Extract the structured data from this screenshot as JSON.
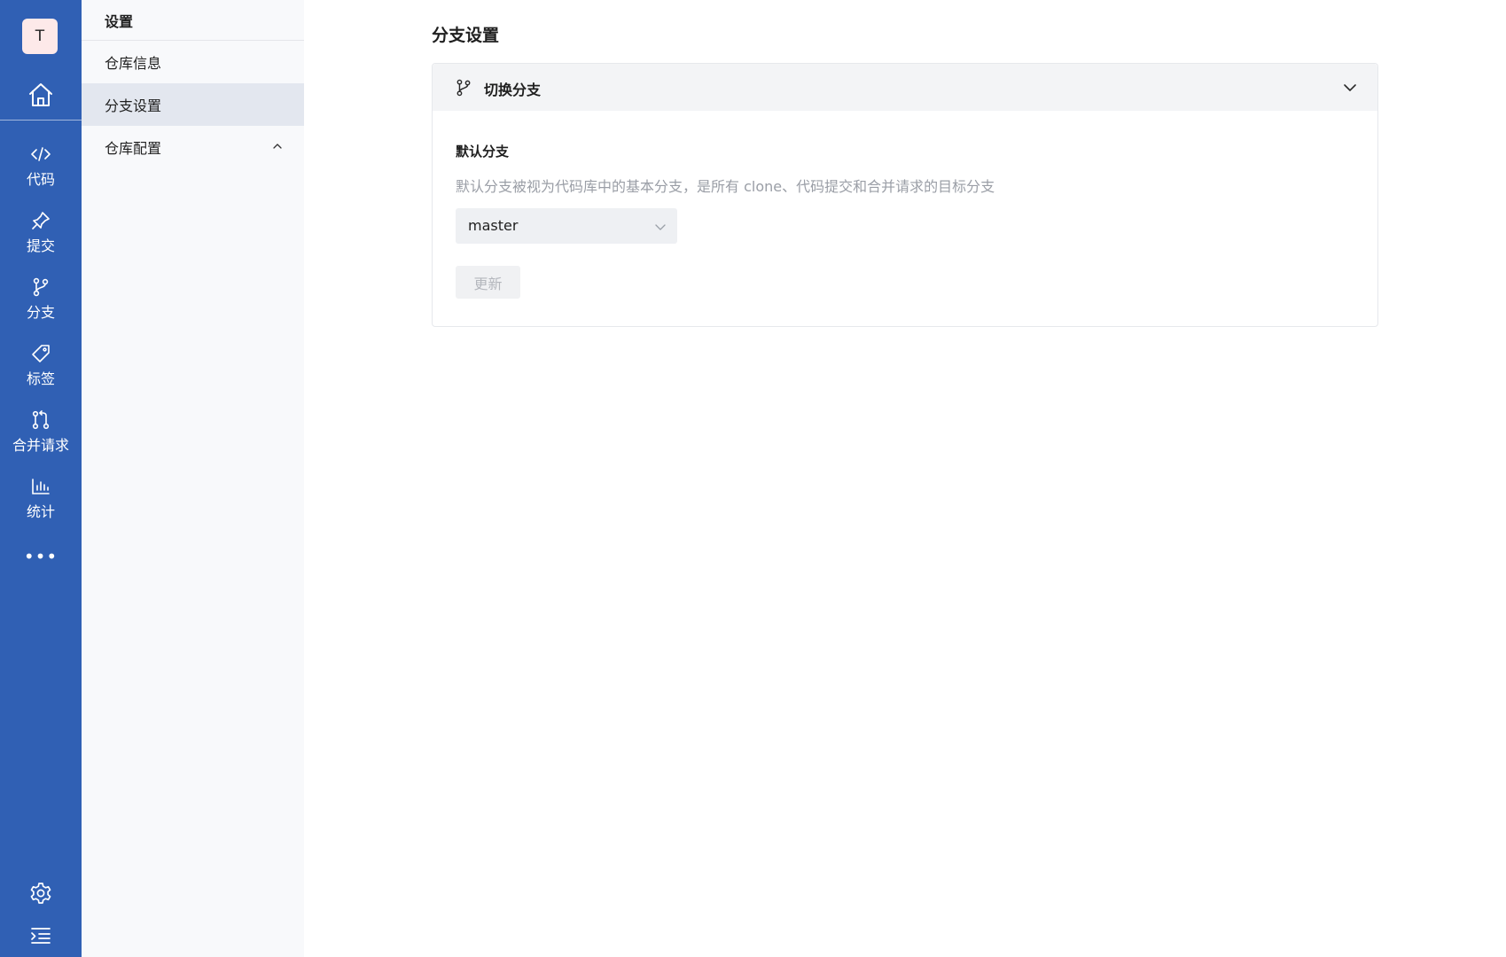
{
  "colors": {
    "rail_bg": "#3060b4",
    "subnav_bg": "#f8f9fb",
    "active_item_bg": "#e3e7ef",
    "card_header_bg": "#f3f4f6",
    "muted_text": "#9a9ea6"
  },
  "rail": {
    "avatar_letter": "T",
    "home_icon": "home-icon",
    "items": [
      {
        "label": "代码",
        "icon": "code-icon"
      },
      {
        "label": "提交",
        "icon": "pin-icon"
      },
      {
        "label": "分支",
        "icon": "branch-icon"
      },
      {
        "label": "标签",
        "icon": "tag-icon"
      },
      {
        "label": "合并请求",
        "icon": "merge-request-icon"
      },
      {
        "label": "统计",
        "icon": "bar-chart-icon"
      }
    ],
    "more": "•••",
    "settings_icon": "gear-icon",
    "collapse_icon": "collapse-menu-icon"
  },
  "subnav": {
    "title": "设置",
    "items": [
      {
        "label": "仓库信息",
        "active": false
      },
      {
        "label": "分支设置",
        "active": true
      },
      {
        "label": "仓库配置",
        "active": false,
        "expandable": true,
        "expanded": true
      }
    ]
  },
  "main": {
    "title": "分支设置",
    "card": {
      "header_label": "切换分支",
      "header_icon": "branch-icon",
      "section_label": "默认分支",
      "description": "默认分支被视为代码库中的基本分支，是所有 clone、代码提交和合并请求的目标分支",
      "select_value": "master",
      "update_button": "更新",
      "update_disabled": true
    }
  }
}
